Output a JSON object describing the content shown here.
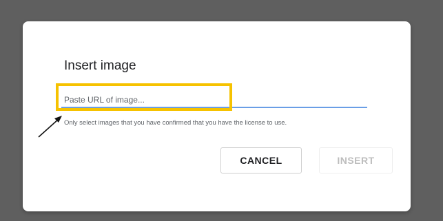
{
  "dialog": {
    "title": "Insert image",
    "url_input": {
      "placeholder": "Paste URL of image...",
      "value": ""
    },
    "helper_text": "Only select images that you have confirmed that you have the license to use.",
    "buttons": {
      "cancel_label": "CANCEL",
      "insert_label": "INSERT"
    }
  },
  "colors": {
    "backdrop": "#5f5f5f",
    "dialog_background": "#ffffff",
    "input_underline": "#6a9ee6",
    "highlight_box": "#f6c200",
    "disabled_text": "#bdbdbd"
  },
  "icons": {
    "annotation_arrow": "arrow-icon"
  }
}
